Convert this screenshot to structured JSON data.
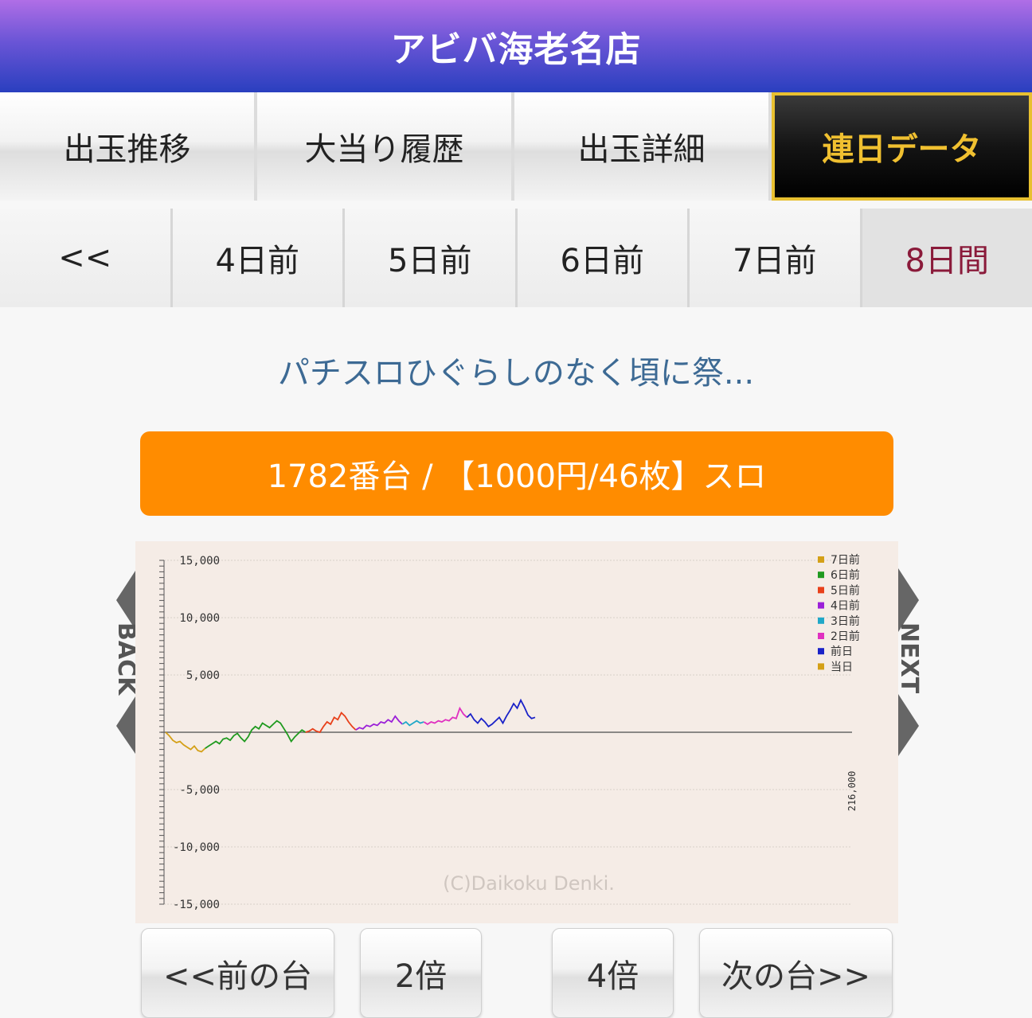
{
  "header": {
    "title": "アビバ海老名店"
  },
  "tabs": [
    {
      "label": "出玉推移"
    },
    {
      "label": "大当り履歴"
    },
    {
      "label": "出玉詳細"
    },
    {
      "label": "連日データ",
      "active": true
    }
  ],
  "days": [
    {
      "label": "<<"
    },
    {
      "label": "4日前"
    },
    {
      "label": "5日前"
    },
    {
      "label": "6日前"
    },
    {
      "label": "7日前"
    },
    {
      "label": "8日間",
      "selected": true
    }
  ],
  "machine": {
    "name": "パチスロひぐらしのなく頃に祭...",
    "info": "1782番台 / 【1000円/46枚】スロ"
  },
  "nav": {
    "back": "BACK",
    "next": "NEXT"
  },
  "chart_data": {
    "type": "line",
    "ylim": [
      -15000,
      15000
    ],
    "ytick_labels": [
      "15,000",
      "10,000",
      "5,000",
      "-5,000",
      "-10,000",
      "-15,000"
    ],
    "yticks": [
      15000,
      10000,
      5000,
      -5000,
      -10000,
      -15000
    ],
    "xmax_label": "216,000",
    "watermark": "(C)Daikoku Denki.",
    "legend_position": "top-right",
    "series": [
      {
        "name": "7日前",
        "color": "#d4a017",
        "values": [
          0,
          -300,
          -700,
          -900,
          -800,
          -1100,
          -1300,
          -1500,
          -1200,
          -1600,
          -1700,
          -1400
        ]
      },
      {
        "name": "6日前",
        "color": "#1f9a1f",
        "values": [
          -1400,
          -1200,
          -1000,
          -800,
          -1000,
          -600,
          -500,
          -700,
          -300,
          -100,
          -500,
          -800,
          -400,
          200,
          500,
          300,
          800,
          600,
          400,
          700,
          1000,
          800,
          300,
          -200,
          -800,
          -400,
          -100,
          200,
          0
        ]
      },
      {
        "name": "5日前",
        "color": "#e8401a",
        "values": [
          0,
          100,
          300,
          100,
          0,
          500,
          900,
          700,
          1300,
          1100,
          1700,
          1400,
          900,
          500,
          200
        ]
      },
      {
        "name": "4日前",
        "color": "#9b1fd8",
        "values": [
          200,
          400,
          300,
          600,
          500,
          700,
          600,
          900,
          800,
          1100,
          900,
          1400,
          1000,
          700
        ]
      },
      {
        "name": "3日前",
        "color": "#20a8c8",
        "values": [
          700,
          900,
          600,
          800,
          1000,
          800,
          900
        ]
      },
      {
        "name": "2日前",
        "color": "#e030c0",
        "values": [
          900,
          700,
          900,
          800,
          1000,
          900,
          1100,
          1000,
          1300,
          1200,
          2100,
          1600,
          1300
        ]
      },
      {
        "name": "前日",
        "color": "#1a22c8",
        "values": [
          1300,
          1600,
          1100,
          800,
          1200,
          900,
          500,
          700,
          1000,
          1300,
          800,
          1400,
          1900,
          2500,
          2100,
          2800,
          2200,
          1500,
          1200,
          1300
        ]
      },
      {
        "name": "当日",
        "color": "#d4a017",
        "values": []
      }
    ]
  },
  "buttons": {
    "prev": "<<前の台",
    "x2": "2倍",
    "x4": "4倍",
    "next": "次の台>>"
  }
}
